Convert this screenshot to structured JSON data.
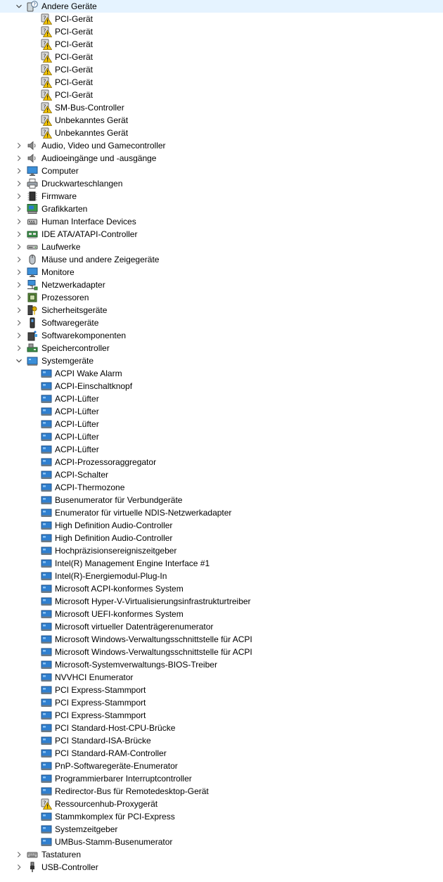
{
  "tree": [
    {
      "label": "Andere Geräte",
      "icon": "unknown-devices-icon",
      "expanded": true,
      "children": [
        {
          "label": "PCI-Gerät",
          "icon": "warning-device-icon"
        },
        {
          "label": "PCI-Gerät",
          "icon": "warning-device-icon"
        },
        {
          "label": "PCI-Gerät",
          "icon": "warning-device-icon"
        },
        {
          "label": "PCI-Gerät",
          "icon": "warning-device-icon"
        },
        {
          "label": "PCI-Gerät",
          "icon": "warning-device-icon"
        },
        {
          "label": "PCI-Gerät",
          "icon": "warning-device-icon"
        },
        {
          "label": "PCI-Gerät",
          "icon": "warning-device-icon"
        },
        {
          "label": "SM-Bus-Controller",
          "icon": "warning-device-icon"
        },
        {
          "label": "Unbekanntes Gerät",
          "icon": "warning-device-icon"
        },
        {
          "label": "Unbekanntes Gerät",
          "icon": "warning-device-icon"
        }
      ]
    },
    {
      "label": "Audio, Video und Gamecontroller",
      "icon": "speaker-icon",
      "expanded": false
    },
    {
      "label": "Audioeingänge und -ausgänge",
      "icon": "speaker-icon",
      "expanded": false
    },
    {
      "label": "Computer",
      "icon": "monitor-icon",
      "expanded": false
    },
    {
      "label": "Druckwarteschlangen",
      "icon": "printer-icon",
      "expanded": false
    },
    {
      "label": "Firmware",
      "icon": "chip-icon",
      "expanded": false
    },
    {
      "label": "Grafikkarten",
      "icon": "display-adapter-icon",
      "expanded": false
    },
    {
      "label": "Human Interface Devices",
      "icon": "hid-icon",
      "expanded": false
    },
    {
      "label": "IDE ATA/ATAPI-Controller",
      "icon": "ide-controller-icon",
      "expanded": false
    },
    {
      "label": "Laufwerke",
      "icon": "disk-drive-icon",
      "expanded": false
    },
    {
      "label": "Mäuse und andere Zeigegeräte",
      "icon": "mouse-icon",
      "expanded": false
    },
    {
      "label": "Monitore",
      "icon": "monitor-icon",
      "expanded": false
    },
    {
      "label": "Netzwerkadapter",
      "icon": "network-icon",
      "expanded": false
    },
    {
      "label": "Prozessoren",
      "icon": "processor-icon",
      "expanded": false
    },
    {
      "label": "Sicherheitsgeräte",
      "icon": "security-key-icon",
      "expanded": false
    },
    {
      "label": "Softwaregeräte",
      "icon": "software-device-icon",
      "expanded": false
    },
    {
      "label": "Softwarekomponenten",
      "icon": "software-component-icon",
      "expanded": false
    },
    {
      "label": "Speichercontroller",
      "icon": "storage-controller-icon",
      "expanded": false
    },
    {
      "label": "Systemgeräte",
      "icon": "system-folder-icon",
      "expanded": true,
      "children": [
        {
          "label": "ACPI Wake Alarm",
          "icon": "system-device-icon"
        },
        {
          "label": "ACPI-Einschaltknopf",
          "icon": "system-device-icon"
        },
        {
          "label": "ACPI-Lüfter",
          "icon": "system-device-icon"
        },
        {
          "label": "ACPI-Lüfter",
          "icon": "system-device-icon"
        },
        {
          "label": "ACPI-Lüfter",
          "icon": "system-device-icon"
        },
        {
          "label": "ACPI-Lüfter",
          "icon": "system-device-icon"
        },
        {
          "label": "ACPI-Lüfter",
          "icon": "system-device-icon"
        },
        {
          "label": "ACPI-Prozessoraggregator",
          "icon": "system-device-icon"
        },
        {
          "label": "ACPI-Schalter",
          "icon": "system-device-icon"
        },
        {
          "label": "ACPI-Thermozone",
          "icon": "system-device-icon"
        },
        {
          "label": "Busenumerator für Verbundgeräte",
          "icon": "system-device-icon"
        },
        {
          "label": "Enumerator für virtuelle NDIS-Netzwerkadapter",
          "icon": "system-device-icon"
        },
        {
          "label": "High Definition Audio-Controller",
          "icon": "system-device-icon"
        },
        {
          "label": "High Definition Audio-Controller",
          "icon": "system-device-icon"
        },
        {
          "label": "Hochpräzisionsereigniszeitgeber",
          "icon": "system-device-icon"
        },
        {
          "label": "Intel(R) Management Engine Interface #1",
          "icon": "system-device-icon"
        },
        {
          "label": "Intel(R)-Energiemodul-Plug-In",
          "icon": "system-device-icon"
        },
        {
          "label": "Microsoft ACPI-konformes System",
          "icon": "system-device-icon"
        },
        {
          "label": "Microsoft Hyper-V-Virtualisierungsinfrastrukturtreiber",
          "icon": "system-device-icon"
        },
        {
          "label": "Microsoft UEFI-konformes System",
          "icon": "system-device-icon"
        },
        {
          "label": "Microsoft virtueller Datenträgerenumerator",
          "icon": "system-device-icon"
        },
        {
          "label": "Microsoft Windows-Verwaltungsschnittstelle für ACPI",
          "icon": "system-device-icon"
        },
        {
          "label": "Microsoft Windows-Verwaltungsschnittstelle für ACPI",
          "icon": "system-device-icon"
        },
        {
          "label": "Microsoft-Systemverwaltungs-BIOS-Treiber",
          "icon": "system-device-icon"
        },
        {
          "label": "NVVHCI Enumerator",
          "icon": "system-device-icon"
        },
        {
          "label": "PCI Express-Stammport",
          "icon": "system-device-icon"
        },
        {
          "label": "PCI Express-Stammport",
          "icon": "system-device-icon"
        },
        {
          "label": "PCI Express-Stammport",
          "icon": "system-device-icon"
        },
        {
          "label": "PCI Standard-Host-CPU-Brücke",
          "icon": "system-device-icon"
        },
        {
          "label": "PCI Standard-ISA-Brücke",
          "icon": "system-device-icon"
        },
        {
          "label": "PCI Standard-RAM-Controller",
          "icon": "system-device-icon"
        },
        {
          "label": "PnP-Softwaregeräte-Enumerator",
          "icon": "system-device-icon"
        },
        {
          "label": "Programmierbarer Interruptcontroller",
          "icon": "system-device-icon"
        },
        {
          "label": "Redirector-Bus für Remotedesktop-Gerät",
          "icon": "system-device-icon"
        },
        {
          "label": "Ressourcenhub-Proxygerät",
          "icon": "warning-device-icon"
        },
        {
          "label": "Stammkomplex für PCI-Express",
          "icon": "system-device-icon"
        },
        {
          "label": "Systemzeitgeber",
          "icon": "system-device-icon"
        },
        {
          "label": "UMBus-Stamm-Busenumerator",
          "icon": "system-device-icon"
        }
      ]
    },
    {
      "label": "Tastaturen",
      "icon": "keyboard-icon",
      "expanded": false
    },
    {
      "label": "USB-Controller",
      "icon": "usb-icon",
      "expanded": false
    }
  ]
}
